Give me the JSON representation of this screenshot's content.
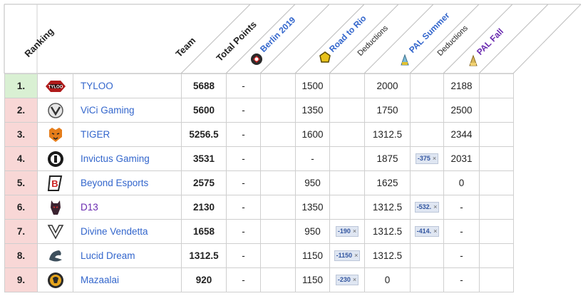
{
  "columns": {
    "ranking": "Ranking",
    "team": "Team",
    "total_points": "Total Points",
    "berlin": "Berlin 2019",
    "road_to_rio": "Road to Rio",
    "deductions_1": "Deductions",
    "pal_summer": "PAL Summer",
    "deductions_2": "Deductions",
    "pal_fall": "PAL Fall"
  },
  "rows": [
    {
      "rank": "1.",
      "team": "TYLOO",
      "total": "5688",
      "berlin": "-",
      "rio": "1500",
      "rio_ded": "",
      "summer": "2000",
      "summer_ded": "",
      "fall": "2188"
    },
    {
      "rank": "2.",
      "team": "ViCi Gaming",
      "total": "5600",
      "berlin": "-",
      "rio": "1350",
      "rio_ded": "",
      "summer": "1750",
      "summer_ded": "",
      "fall": "2500"
    },
    {
      "rank": "3.",
      "team": "TIGER",
      "total": "5256.5",
      "berlin": "-",
      "rio": "1600",
      "rio_ded": "",
      "summer": "1312.5",
      "summer_ded": "",
      "fall": "2344"
    },
    {
      "rank": "4.",
      "team": "Invictus Gaming",
      "total": "3531",
      "berlin": "-",
      "rio": "-",
      "rio_ded": "",
      "summer": "1875",
      "summer_ded": "-375",
      "fall": "2031"
    },
    {
      "rank": "5.",
      "team": "Beyond Esports",
      "total": "2575",
      "berlin": "-",
      "rio": "950",
      "rio_ded": "",
      "summer": "1625",
      "summer_ded": "",
      "fall": "0"
    },
    {
      "rank": "6.",
      "team": "D13",
      "total": "2130",
      "berlin": "-",
      "rio": "1350",
      "rio_ded": "",
      "summer": "1312.5",
      "summer_ded": "-532.",
      "fall": "-"
    },
    {
      "rank": "7.",
      "team": "Divine Vendetta",
      "total": "1658",
      "berlin": "-",
      "rio": "950",
      "rio_ded": "-190",
      "summer": "1312.5",
      "summer_ded": "-414.",
      "fall": "-"
    },
    {
      "rank": "8.",
      "team": "Lucid Dream",
      "total": "1312.5",
      "berlin": "-",
      "rio": "1150",
      "rio_ded": "-1150",
      "summer": "1312.5",
      "summer_ded": "",
      "fall": "-"
    },
    {
      "rank": "9.",
      "team": "Mazaalai",
      "total": "920",
      "berlin": "-",
      "rio": "1150",
      "rio_ded": "-230",
      "summer": "0",
      "summer_ded": "",
      "fall": "-"
    }
  ],
  "dismiss_glyph": "×",
  "colors": {
    "first_place": "#d9f0d3",
    "other_place": "#f8d7d6",
    "link": "#3366cc",
    "visited": "#6a2bb0"
  }
}
